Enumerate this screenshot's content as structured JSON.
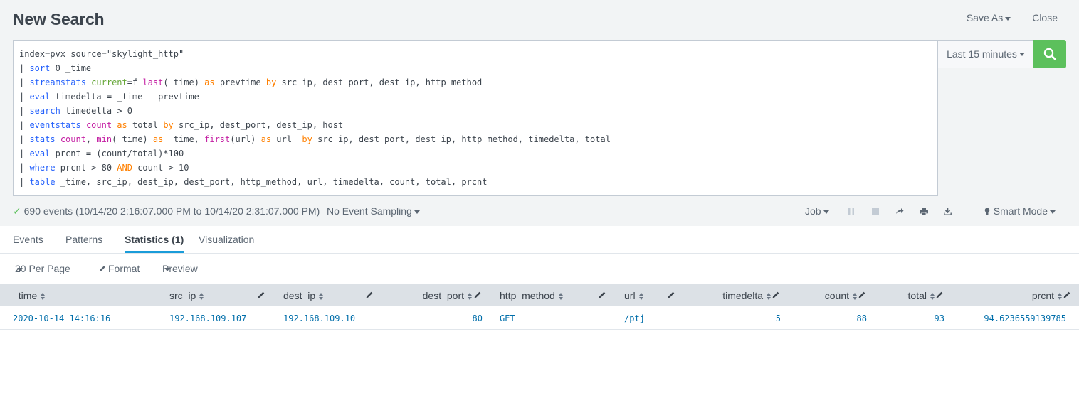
{
  "header": {
    "title": "New Search",
    "save_as": "Save As",
    "close": "Close"
  },
  "search": {
    "lines": [
      [
        {
          "t": "index=pvx source=\"skylight_http\"",
          "c": ""
        }
      ],
      [
        {
          "t": "| ",
          "c": ""
        },
        {
          "t": "sort",
          "c": "kw"
        },
        {
          "t": " 0 _time",
          "c": ""
        }
      ],
      [
        {
          "t": "| ",
          "c": ""
        },
        {
          "t": "streamstats",
          "c": "kw"
        },
        {
          "t": " ",
          "c": ""
        },
        {
          "t": "current",
          "c": "opt"
        },
        {
          "t": "=f ",
          "c": ""
        },
        {
          "t": "last",
          "c": "fn"
        },
        {
          "t": "(_time) ",
          "c": ""
        },
        {
          "t": "as",
          "c": "arg"
        },
        {
          "t": " prevtime ",
          "c": ""
        },
        {
          "t": "by",
          "c": "arg"
        },
        {
          "t": " src_ip, dest_port, dest_ip, http_method",
          "c": ""
        }
      ],
      [
        {
          "t": "| ",
          "c": ""
        },
        {
          "t": "eval",
          "c": "kw"
        },
        {
          "t": " timedelta = _time - prevtime",
          "c": ""
        }
      ],
      [
        {
          "t": "| ",
          "c": ""
        },
        {
          "t": "search",
          "c": "kw"
        },
        {
          "t": " timedelta > 0",
          "c": ""
        }
      ],
      [
        {
          "t": "| ",
          "c": ""
        },
        {
          "t": "eventstats",
          "c": "kw"
        },
        {
          "t": " ",
          "c": ""
        },
        {
          "t": "count",
          "c": "fn"
        },
        {
          "t": " ",
          "c": ""
        },
        {
          "t": "as",
          "c": "arg"
        },
        {
          "t": " total ",
          "c": ""
        },
        {
          "t": "by",
          "c": "arg"
        },
        {
          "t": " src_ip, dest_port, dest_ip, host",
          "c": ""
        }
      ],
      [
        {
          "t": "| ",
          "c": ""
        },
        {
          "t": "stats",
          "c": "kw"
        },
        {
          "t": " ",
          "c": ""
        },
        {
          "t": "count",
          "c": "fn"
        },
        {
          "t": ", ",
          "c": ""
        },
        {
          "t": "min",
          "c": "fn"
        },
        {
          "t": "(_time) ",
          "c": ""
        },
        {
          "t": "as",
          "c": "arg"
        },
        {
          "t": " _time, ",
          "c": ""
        },
        {
          "t": "first",
          "c": "fn"
        },
        {
          "t": "(url) ",
          "c": ""
        },
        {
          "t": "as",
          "c": "arg"
        },
        {
          "t": " url  ",
          "c": ""
        },
        {
          "t": "by",
          "c": "arg"
        },
        {
          "t": " src_ip, dest_port, dest_ip, http_method, timedelta, total",
          "c": ""
        }
      ],
      [
        {
          "t": "| ",
          "c": ""
        },
        {
          "t": "eval",
          "c": "kw"
        },
        {
          "t": " prcnt = (count/total)*100",
          "c": ""
        }
      ],
      [
        {
          "t": "| ",
          "c": ""
        },
        {
          "t": "where",
          "c": "kw"
        },
        {
          "t": " prcnt > 80 ",
          "c": ""
        },
        {
          "t": "AND",
          "c": "arg"
        },
        {
          "t": " count > 10",
          "c": ""
        }
      ],
      [
        {
          "t": "| ",
          "c": ""
        },
        {
          "t": "table",
          "c": "kw"
        },
        {
          "t": " _time, src_ip, dest_ip, dest_port, http_method, url, timedelta, count, total, prcnt",
          "c": ""
        }
      ]
    ],
    "time_range": "Last 15 minutes",
    "colors": {
      "keyword": "#2662fc",
      "argument": "#ff8000",
      "function": "#c41fa3",
      "option": "#65a637",
      "button": "#5cc05c"
    }
  },
  "status": {
    "summary": "690 events (10/14/20 2:16:07.000 PM to 10/14/20 2:31:07.000 PM)",
    "sampling": "No Event Sampling",
    "job": "Job",
    "mode": "Smart Mode"
  },
  "tabs": [
    "Events",
    "Patterns",
    "Statistics (1)",
    "Visualization"
  ],
  "active_tab": "Statistics (1)",
  "toolbar": {
    "per_page": "20 Per Page",
    "format": "Format",
    "preview": "Preview"
  },
  "table": {
    "columns": [
      "_time",
      "src_ip",
      "dest_ip",
      "dest_port",
      "http_method",
      "url",
      "timedelta",
      "count",
      "total",
      "prcnt"
    ],
    "rows": [
      [
        "2020-10-14 14:16:16",
        "192.168.109.107",
        "192.168.109.10",
        "80",
        "GET",
        "/ptj",
        "5",
        "88",
        "93",
        "94.6236559139785"
      ]
    ]
  }
}
